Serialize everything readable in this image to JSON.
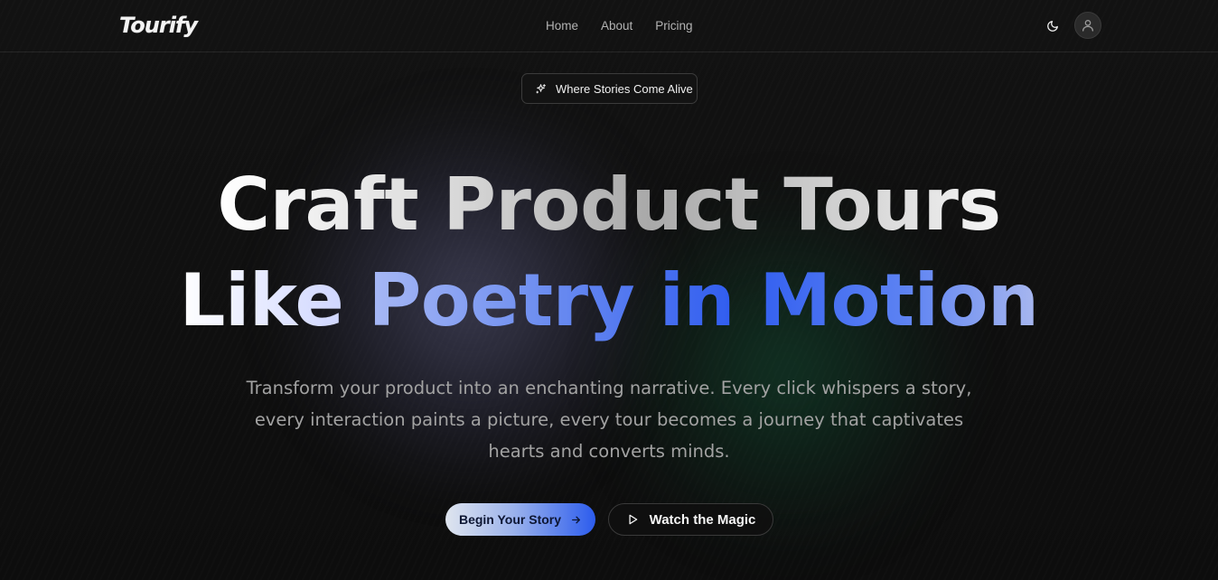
{
  "brand": {
    "logo_text": "Tourify"
  },
  "nav": {
    "items": [
      {
        "label": "Home"
      },
      {
        "label": "About"
      },
      {
        "label": "Pricing"
      }
    ]
  },
  "header_icons": {
    "theme_toggle": "moon-icon",
    "avatar": "user-icon"
  },
  "badge": {
    "icon": "sparkles-icon",
    "label": "Where Stories Come Alive"
  },
  "hero": {
    "line1": "Craft Product Tours",
    "line2_part1": "Like",
    "line2_highlight": "Poetry in Motion",
    "subtext_lines": [
      "Transform your product into an enchanting narrative. Every click whispers a story,",
      "every interaction paints a picture, every tour becomes a journey that captivates",
      "hearts and converts minds."
    ]
  },
  "cta": {
    "primary_label": "Begin Your Story",
    "primary_icon": "arrow-right-icon",
    "secondary_label": "Watch the Magic",
    "secondary_icon": "play-icon"
  },
  "colors": {
    "background": "#0c0c0c",
    "accent_blue": "#2f5cf0",
    "muted_text": "#a2a2a2"
  }
}
